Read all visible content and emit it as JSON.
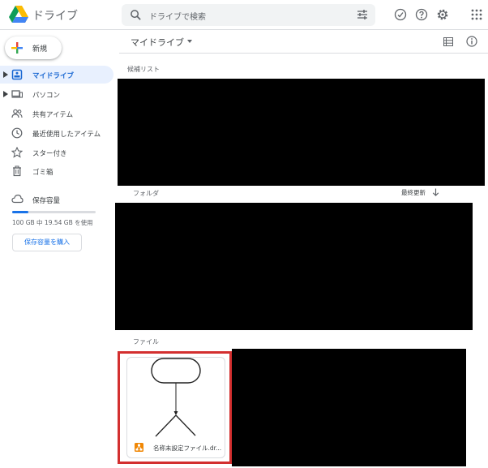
{
  "app": {
    "name": "ドライブ"
  },
  "search": {
    "placeholder": "ドライブで検索"
  },
  "sidebar": {
    "new_label": "新規",
    "items": [
      {
        "label": "マイドライブ",
        "active": true
      },
      {
        "label": "パソコン",
        "active": false
      },
      {
        "label": "共有アイテム",
        "active": false
      },
      {
        "label": "最近使用したアイテム",
        "active": false
      },
      {
        "label": "スター付き",
        "active": false
      },
      {
        "label": "ゴミ箱",
        "active": false
      }
    ],
    "storage": {
      "label": "保存容量",
      "usage_text": "100 GB 中 19.54 GB を使用",
      "used_fraction": 0.1954,
      "buy_label": "保存容量を購入"
    }
  },
  "main": {
    "title": "マイドライブ",
    "suggested_label": "候補リスト",
    "folders_label": "フォルダ",
    "sort_label": "最終更新",
    "files_label": "ファイル",
    "file": {
      "name": "名称未設定ファイル.dr..."
    }
  },
  "colors": {
    "accent": "#1a73e8",
    "active_bg": "#e8f0fe",
    "highlight": "#d32f2f"
  }
}
